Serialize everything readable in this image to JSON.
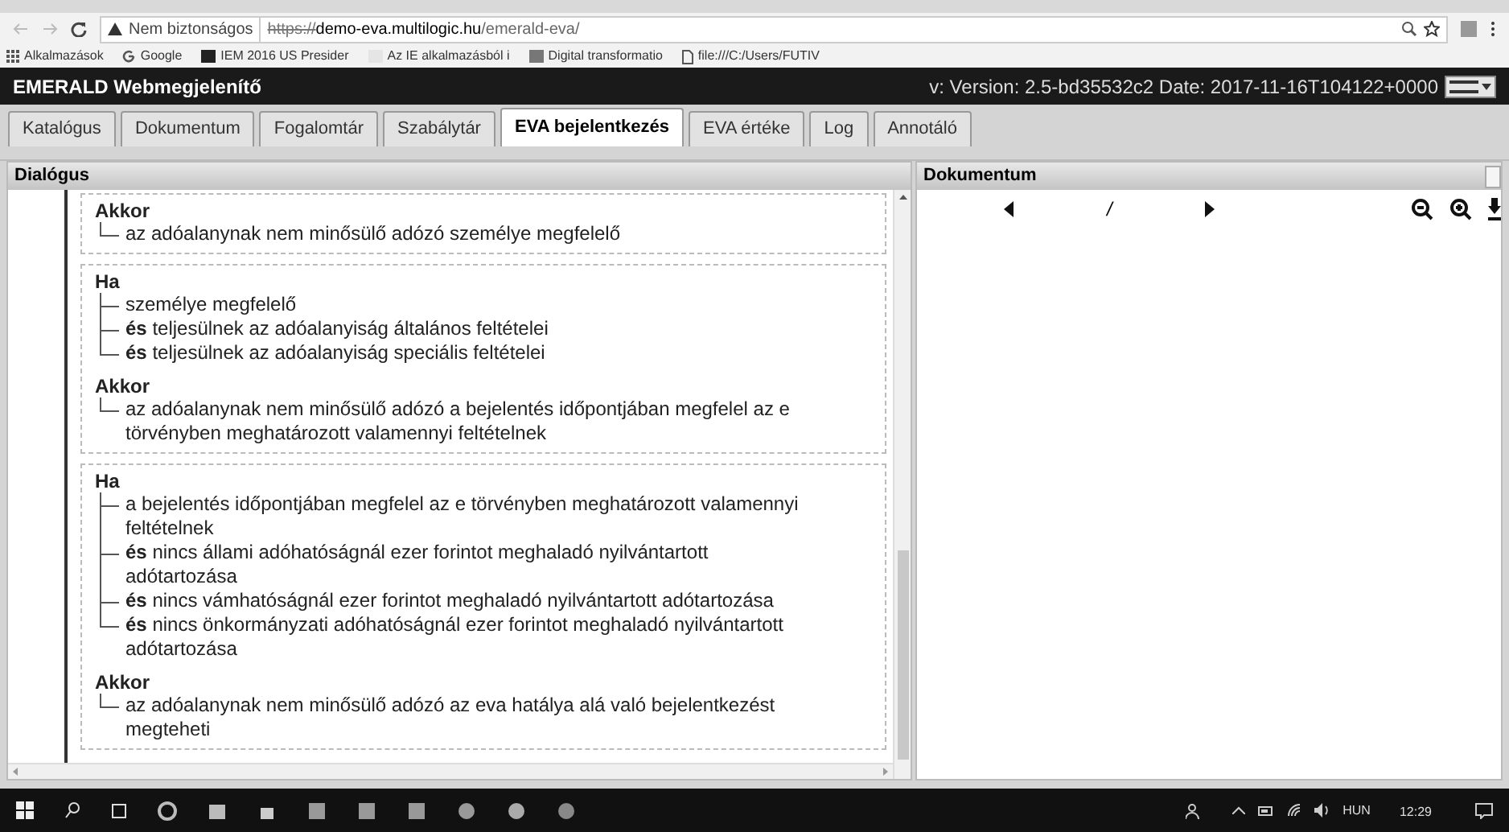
{
  "browser": {
    "security": "Nem biztonságos",
    "url_scheme": "https://",
    "url_host": "demo-eva.multilogic.hu",
    "url_path": "/emerald-eva/",
    "bookmarks": [
      {
        "label": "Alkalmazások",
        "kind": "apps"
      },
      {
        "label": "Google",
        "kind": "google"
      },
      {
        "label": "IEM 2016 US Presider",
        "kind": "dark"
      },
      {
        "label": "Az IE alkalmazásból i",
        "kind": "light"
      },
      {
        "label": "Digital transformatio",
        "kind": "grey"
      },
      {
        "label": "file:///C:/Users/FUTIV",
        "kind": "file"
      }
    ]
  },
  "app": {
    "title": "EMERALD Webmegjelenítő",
    "version": "v: Version: 2.5-bd35532c2 Date: 2017-11-16T104122+0000"
  },
  "tabs": [
    {
      "label": "Katalógus",
      "selected": false
    },
    {
      "label": "Dokumentum",
      "selected": false
    },
    {
      "label": "Fogalomtár",
      "selected": false
    },
    {
      "label": "Szabálytár",
      "selected": false
    },
    {
      "label": "EVA bejelentkezés",
      "selected": true
    },
    {
      "label": "EVA értéke",
      "selected": false
    },
    {
      "label": "Log",
      "selected": false
    },
    {
      "label": "Annotáló",
      "selected": false
    }
  ],
  "dialog": {
    "title": "Dialógus",
    "blocks": [
      {
        "sections": [
          {
            "label": "Akkor",
            "items": [
              "az adóalanynak nem minősülő adózó személye megfelelő"
            ]
          }
        ]
      },
      {
        "sections": [
          {
            "label": "Ha",
            "items": [
              "személye megfelelő",
              "**és** teljesülnek az adóalanyiság általános feltételei",
              "**és** teljesülnek az adóalanyiság speciális feltételei"
            ]
          },
          {
            "label": "Akkor",
            "items": [
              "az adóalanynak nem minősülő adózó a bejelentés időpontjában megfelel az e törvényben meghatározott valamennyi feltételnek"
            ]
          }
        ]
      },
      {
        "sections": [
          {
            "label": "Ha",
            "items": [
              "a bejelentés időpontjában megfelel az e törvényben meghatározott valamennyi feltételnek",
              "**és** nincs állami adóhatóságnál ezer forintot meghaladó nyilvántartott adótartozása",
              "**és** nincs vámhatóságnál ezer forintot meghaladó nyilvántartott adótartozása",
              "**és** nincs önkormányzati adóhatóságnál ezer forintot meghaladó nyilvántartott adótartozása"
            ]
          },
          {
            "label": "Akkor",
            "items": [
              "az adóalanynak nem minősülő adózó az eva hatálya alá való bejelentkezést megteheti"
            ]
          }
        ]
      }
    ]
  },
  "document": {
    "title": "Dokumentum",
    "page_separator": "/"
  },
  "taskbar": {
    "language": "HUN",
    "time": "12:29"
  }
}
